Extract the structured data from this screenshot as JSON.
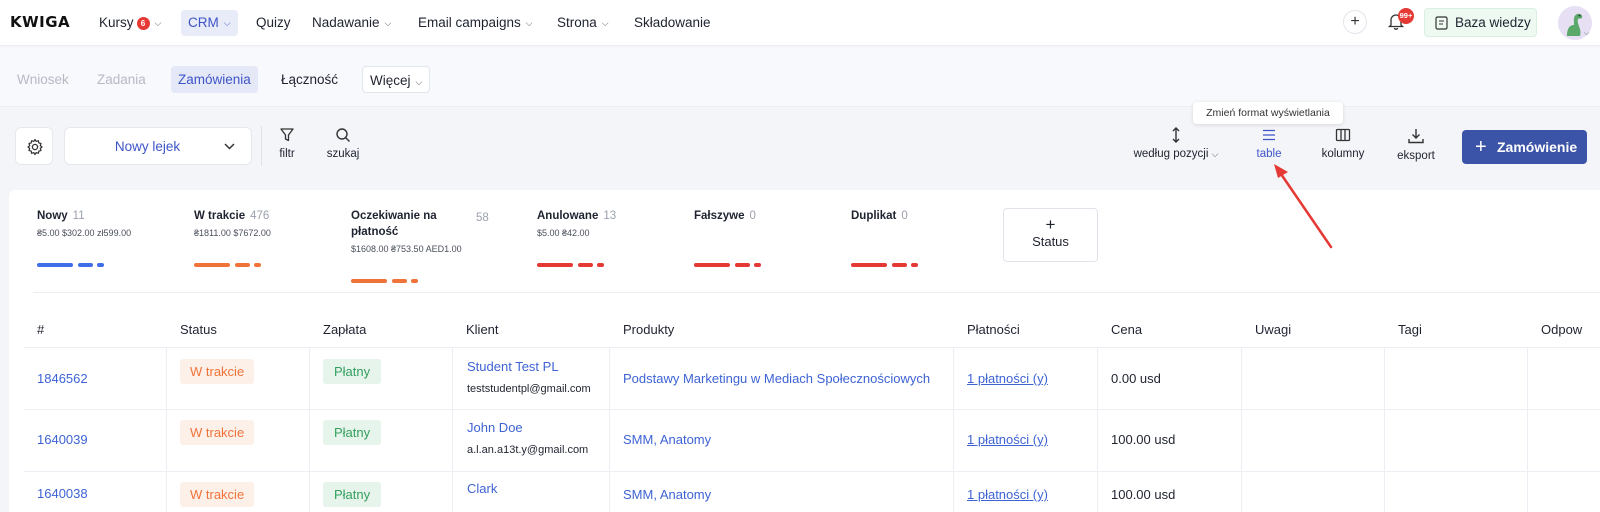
{
  "app": {
    "logo": "KWIGA"
  },
  "topnav": {
    "items": [
      {
        "label": "Kursy",
        "badge": "6",
        "dropdown": true
      },
      {
        "label": "CRM",
        "dropdown": true,
        "active": true
      },
      {
        "label": "Quizy"
      },
      {
        "label": "Nadawanie",
        "dropdown": true
      },
      {
        "label": "Email campaigns",
        "dropdown": true
      },
      {
        "label": "Strona",
        "dropdown": true
      },
      {
        "label": "Składowanie"
      }
    ],
    "notifications_badge": "99+",
    "knowledge_base_label": "Baza wiedzy"
  },
  "subnav": {
    "items": [
      {
        "label": "Wniosek"
      },
      {
        "label": "Zadania"
      },
      {
        "label": "Zamówienia"
      },
      {
        "label": "Łączność"
      },
      {
        "label": "Więcej"
      }
    ]
  },
  "toolbar": {
    "funnel_select": "Nowy lejek",
    "filter_label": "filtr",
    "search_label": "szukaj",
    "sort_label": "według pozycji",
    "view_label": "table",
    "columns_label": "kolumny",
    "export_label": "eksport",
    "new_order_label": "Zamówienie",
    "tooltip": "Zmień format wyświetlania"
  },
  "statuses": [
    {
      "name": "Nowy",
      "count": "11",
      "sums": "₴5.00 $302.00 zł599.00",
      "color": "#3f6ee8"
    },
    {
      "name": "W trakcie",
      "count": "476",
      "sums": "₴1811.00 $7672.00",
      "color": "#f0733a"
    },
    {
      "name": "Oczekiwanie na płatność",
      "count": "58",
      "sums": "$1608.00 ₴753.50 AED1.00",
      "color": "#f0733a"
    },
    {
      "name": "Anulowane",
      "count": "13",
      "sums": "$5.00 ₴42.00",
      "color": "#e53935"
    },
    {
      "name": "Fałszywe",
      "count": "0",
      "sums": "",
      "color": "#e53935"
    },
    {
      "name": "Duplikat",
      "count": "0",
      "sums": "",
      "color": "#e53935"
    }
  ],
  "add_status_label": "Status",
  "table": {
    "columns": [
      "#",
      "Status",
      "Zapłata",
      "Klient",
      "Produkty",
      "Płatności",
      "Cena",
      "Uwagi",
      "Tagi",
      "Odpow"
    ],
    "rows": [
      {
        "id": "1846562",
        "status": "W trakcie",
        "payment": "Płatny",
        "client_name": "Student Test PL",
        "client_email": "teststudentpl@gmail.com",
        "products": "Podstawy Marketingu w Mediach Społecznościowych",
        "payments": "1 płatności (y)",
        "price": "0.00 usd"
      },
      {
        "id": "1640039",
        "status": "W trakcie",
        "payment": "Płatny",
        "client_name": "John Doe",
        "client_email": "a.l.an.a13t.y@gmail.com",
        "products": "SMM, Anatomy",
        "payments": "1 płatności (y)",
        "price": "100.00 usd"
      },
      {
        "id": "1640038",
        "status": "W trakcie",
        "payment": "Płatny",
        "client_name": "Clark",
        "client_email": "",
        "products": "SMM, Anatomy",
        "payments": "1 płatności (y)",
        "price": "100.00 usd"
      }
    ]
  },
  "colors": {
    "accent": "#3e55c8",
    "primary_button": "#3c54a8",
    "link": "#3e63d4",
    "annotation_arrow": "#e53935"
  }
}
